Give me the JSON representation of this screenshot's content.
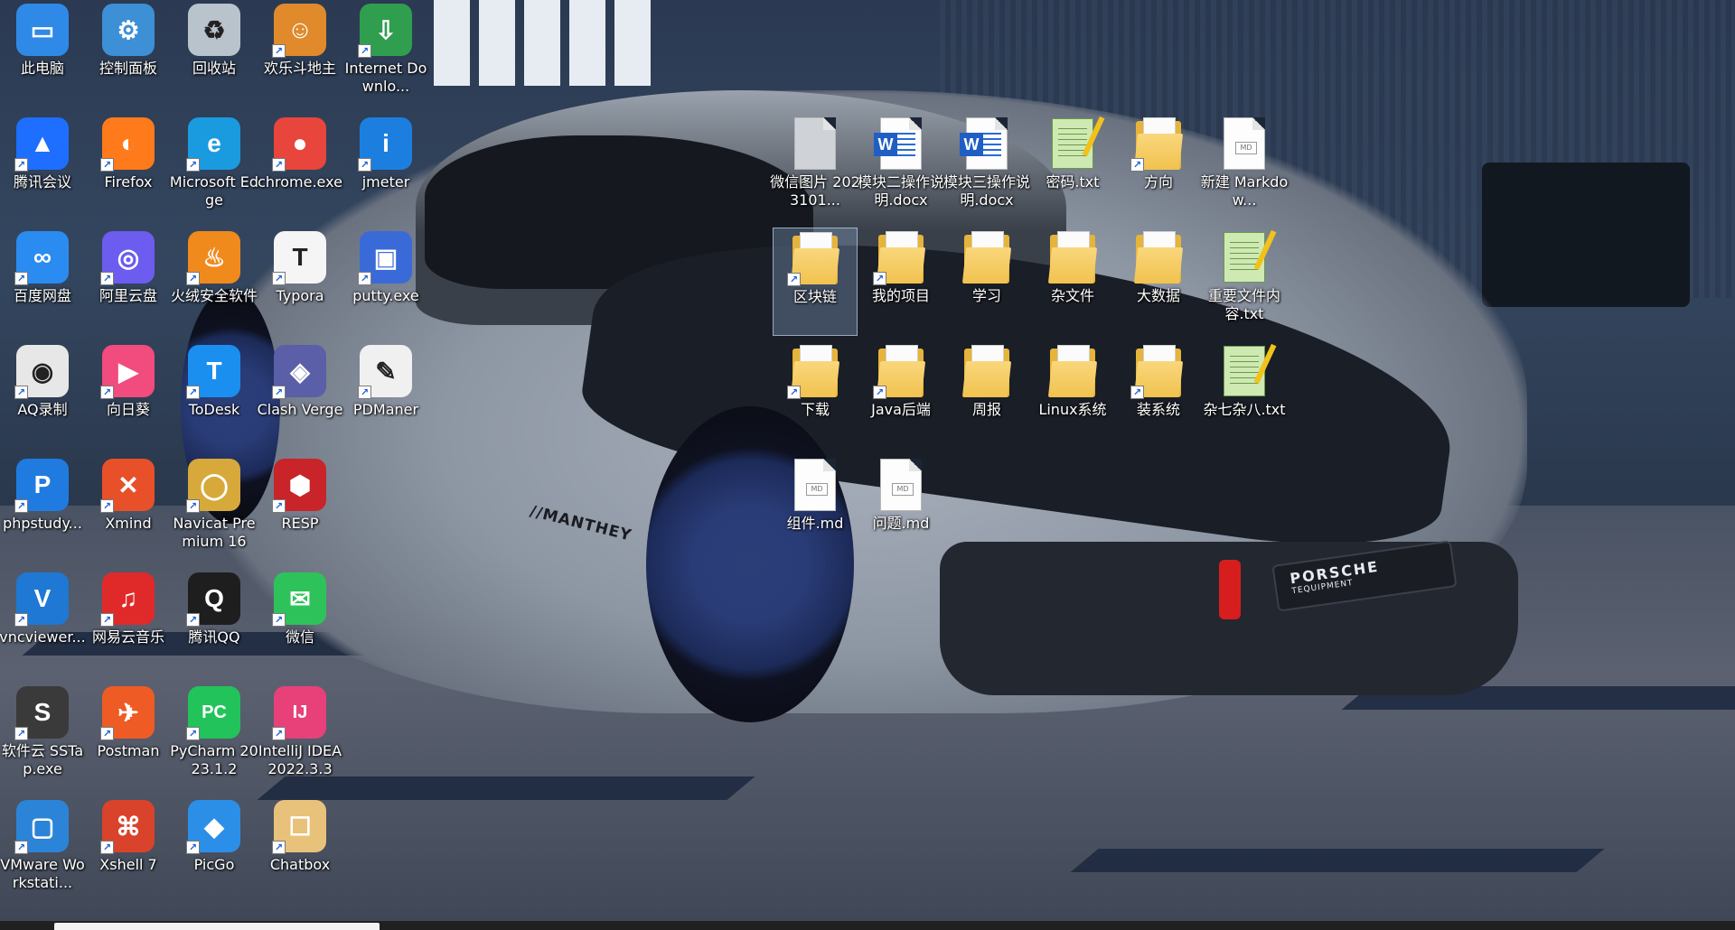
{
  "desktop": {
    "icons": [
      {
        "label": "此电脑",
        "icon": "computer-icon",
        "shortcut": false
      },
      {
        "label": "控制面板",
        "icon": "control-panel-icon",
        "shortcut": false
      },
      {
        "label": "回收站",
        "icon": "recycle-bin-icon",
        "shortcut": false
      },
      {
        "label": "欢乐斗地主",
        "icon": "doudizhu-icon",
        "shortcut": true
      },
      {
        "label": "Internet Downlo...",
        "icon": "internet-download-manager-icon",
        "shortcut": true
      },
      {
        "label": "腾讯会议",
        "icon": "tencent-meeting-icon",
        "shortcut": true
      },
      {
        "label": "Firefox",
        "icon": "firefox-icon",
        "shortcut": true
      },
      {
        "label": "Microsoft Edge",
        "icon": "edge-icon",
        "shortcut": true
      },
      {
        "label": "chrome.exe",
        "icon": "chrome-icon",
        "shortcut": true
      },
      {
        "label": "jmeter",
        "icon": "jmeter-icon",
        "shortcut": true
      },
      {
        "label": "百度网盘",
        "icon": "baidu-netdisk-icon",
        "shortcut": true
      },
      {
        "label": "阿里云盘",
        "icon": "aliyun-drive-icon",
        "shortcut": true
      },
      {
        "label": "火绒安全软件",
        "icon": "huorong-security-icon",
        "shortcut": true
      },
      {
        "label": "Typora",
        "icon": "typora-icon",
        "shortcut": true
      },
      {
        "label": "putty.exe",
        "icon": "putty-icon",
        "shortcut": true
      },
      {
        "label": "AQ录制",
        "icon": "aq-recorder-icon",
        "shortcut": true
      },
      {
        "label": "向日葵",
        "icon": "sunflower-remote-icon",
        "shortcut": true
      },
      {
        "label": "ToDesk",
        "icon": "todesk-icon",
        "shortcut": true
      },
      {
        "label": "Clash Verge",
        "icon": "clash-verge-icon",
        "shortcut": true
      },
      {
        "label": "PDManer",
        "icon": "pdmaner-icon",
        "shortcut": true
      },
      {
        "label": "phpstudy...",
        "icon": "phpstudy-icon",
        "shortcut": true
      },
      {
        "label": "Xmind",
        "icon": "xmind-icon",
        "shortcut": true
      },
      {
        "label": "Navicat Premium 16",
        "icon": "navicat-icon",
        "shortcut": true
      },
      {
        "label": "RESP",
        "icon": "resp-icon",
        "shortcut": true
      },
      {
        "label": "vncviewer...",
        "icon": "vncviewer-icon",
        "shortcut": true
      },
      {
        "label": "网易云音乐",
        "icon": "netease-music-icon",
        "shortcut": true
      },
      {
        "label": "腾讯QQ",
        "icon": "qq-icon",
        "shortcut": true
      },
      {
        "label": "微信",
        "icon": "wechat-icon",
        "shortcut": true
      },
      {
        "label": "软件云 SSTap.exe",
        "icon": "sstap-icon",
        "shortcut": true
      },
      {
        "label": "Postman",
        "icon": "postman-icon",
        "shortcut": true
      },
      {
        "label": "PyCharm 2023.1.2",
        "icon": "pycharm-icon",
        "shortcut": true
      },
      {
        "label": "IntelliJ IDEA 2022.3.3",
        "icon": "intellij-icon",
        "shortcut": true
      },
      {
        "label": "VMware Workstati...",
        "icon": "vmware-icon",
        "shortcut": true
      },
      {
        "label": "Xshell 7",
        "icon": "xshell-icon",
        "shortcut": true
      },
      {
        "label": "PicGo",
        "icon": "picgo-icon",
        "shortcut": true
      },
      {
        "label": "Chatbox",
        "icon": "chatbox-icon",
        "shortcut": true
      },
      {
        "label": "微信图片 2023101...",
        "icon": "image-file-icon",
        "shortcut": false
      },
      {
        "label": "模块二操作说明.docx",
        "icon": "word-document-icon",
        "shortcut": false
      },
      {
        "label": "模块三操作说明.docx",
        "icon": "word-document-icon",
        "shortcut": false
      },
      {
        "label": "密码.txt",
        "icon": "text-file-icon",
        "shortcut": false
      },
      {
        "label": "方向",
        "icon": "folder-icon",
        "shortcut": true
      },
      {
        "label": "新建 Markdow...",
        "icon": "markdown-file-icon",
        "shortcut": false
      },
      {
        "label": "区块链",
        "icon": "folder-icon",
        "shortcut": true,
        "selected": true
      },
      {
        "label": "我的项目",
        "icon": "folder-icon",
        "shortcut": true
      },
      {
        "label": "学习",
        "icon": "folder-icon",
        "shortcut": false
      },
      {
        "label": "杂文件",
        "icon": "folder-icon",
        "shortcut": false
      },
      {
        "label": "大数据",
        "icon": "folder-icon",
        "shortcut": false
      },
      {
        "label": "重要文件内容.txt",
        "icon": "text-file-icon",
        "shortcut": false
      },
      {
        "label": "下载",
        "icon": "folder-icon",
        "shortcut": true
      },
      {
        "label": "Java后端",
        "icon": "folder-icon",
        "shortcut": true
      },
      {
        "label": "周报",
        "icon": "folder-icon",
        "shortcut": false
      },
      {
        "label": "Linux系统",
        "icon": "folder-icon",
        "shortcut": false
      },
      {
        "label": "装系统",
        "icon": "folder-icon",
        "shortcut": true
      },
      {
        "label": "杂七杂八.txt",
        "icon": "text-file-icon",
        "shortcut": false
      },
      {
        "label": "组件.md",
        "icon": "markdown-file-icon",
        "shortcut": false
      },
      {
        "label": "问题.md",
        "icon": "markdown-file-icon",
        "shortcut": false
      }
    ]
  },
  "wallpaper": {
    "plate_text": "PORSCHE",
    "plate_sub": "TEQUIPMENT",
    "side_text": "//MANTHEY"
  },
  "colors": {
    "selection": "#8caad2",
    "folder": "#f1c24f",
    "word": "#1f5ec4",
    "taskbar": "#202020"
  }
}
